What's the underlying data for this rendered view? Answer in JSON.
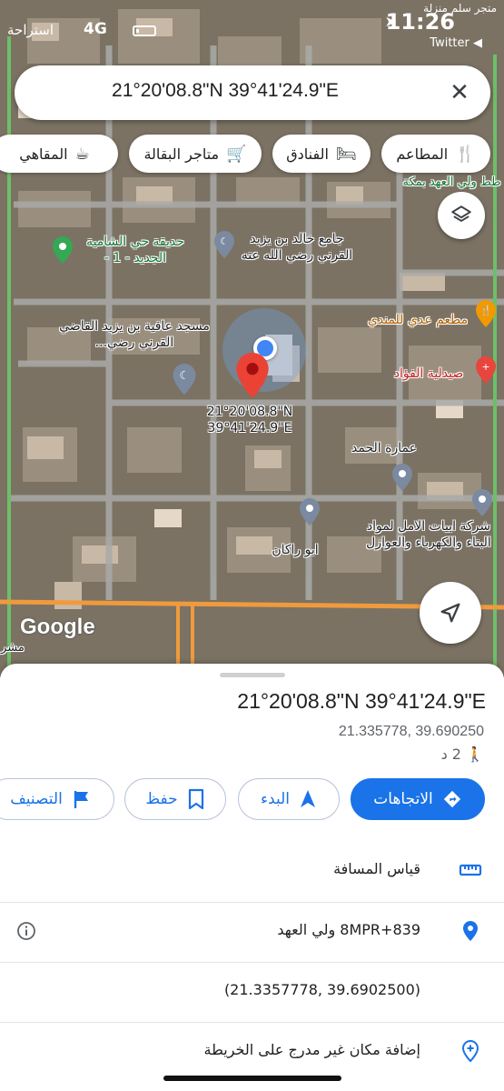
{
  "status_bar": {
    "carrier": "استراحة",
    "network": "4G",
    "time": "11:26",
    "back_app": "Twitter ◀",
    "top_right": "متجر سلم منزلة"
  },
  "search": {
    "query": "21°20'08.8\"N 39°41'24.9\"E",
    "close_icon": "close-icon"
  },
  "chips": [
    {
      "label": "المطاعم",
      "icon": "restaurant-icon"
    },
    {
      "label": "الفنادق",
      "icon": "hotel-icon"
    },
    {
      "label": "متاجر البقالة",
      "icon": "grocery-cart-icon"
    },
    {
      "label": "المقاهي",
      "icon": "coffee-icon"
    }
  ],
  "map": {
    "google_logo": "Google",
    "pin_label_lat": "21°20'08.8\"N",
    "pin_label_lng": "39°41'24.9\"E",
    "poi": {
      "mosque_khalid": "جامع خالد بن يزيد القرني رضي الله عنه",
      "park_shamia": "حديقة حي الشامية الجديد - 1 -",
      "mosque_afia": "مسجد عافية بن يزيد القاضي القرني رضي...",
      "restaurant_adi": "مطعم عدي للمندي",
      "pharmacy_fouad": "صيدلية الفؤاد",
      "building_hamad": "عمارة الحمد",
      "abu_rakan": "ابو راكان",
      "company_abyat": "شركة ابيات الامل لمواد البناء والكهرباء والعوازل",
      "road_label": "طط ولي العهد بمكة",
      "left_edge_bottom": "مشر"
    }
  },
  "sheet": {
    "title": "21°20'08.8\"N 39°41'24.9\"E",
    "decimal": "21.335778, 39.690250",
    "walk_time": "2 د",
    "actions": {
      "directions": "الاتجاهات",
      "start": "البدء",
      "save": "حفظ",
      "label": "التصنيف"
    },
    "rows": {
      "measure": "قياس المسافة",
      "plus_code": "8MPR+839 ولي العهد",
      "coords": "(21.3357778, 39.6902500)",
      "add_place": "إضافة مكان غير مدرج على الخريطة"
    }
  },
  "colors": {
    "accent": "#1a73e8",
    "pin": "#ea4335",
    "map_bg": "#7d7465"
  }
}
